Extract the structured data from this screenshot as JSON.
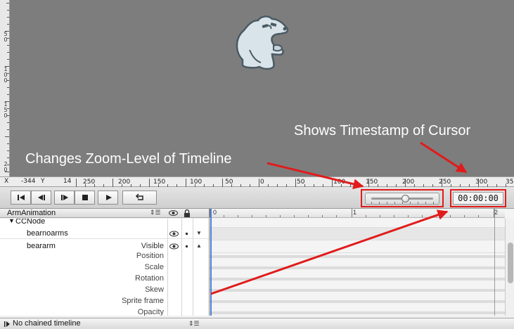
{
  "annotations": {
    "timestamp_note": "Shows Timestamp of Cursor",
    "zoom_note": "Changes Zoom-Level of Timeline",
    "arrow_color": "#e11b1b"
  },
  "ruler": {
    "x_label": "X",
    "x_value": "-344",
    "y_label": "Y",
    "y_value": "14",
    "h_ticks": [
      "250",
      "200",
      "150",
      "100",
      "50",
      "0",
      "50",
      "100",
      "150",
      "200",
      "250",
      "300",
      "35"
    ],
    "v_ticks": [
      "0",
      "5 0",
      "1 0 0",
      "1 5 0",
      "2 0"
    ]
  },
  "toolbar": {
    "buttons": [
      "jump-start",
      "step-back",
      "step-forward",
      "stop",
      "play",
      "loop"
    ],
    "zoom_level": 0.55,
    "timestamp": "00:00:00"
  },
  "timeline": {
    "sequence_name": "ArmAnimation",
    "root_node": "CCNode",
    "nodes": [
      {
        "name": "bearnoarms"
      },
      {
        "name": "beararm",
        "prop": "Visible"
      }
    ],
    "properties": [
      "Position",
      "Scale",
      "Rotation",
      "Skew",
      "Sprite frame",
      "Opacity"
    ],
    "ruler_labels": [
      "0",
      "1",
      "2"
    ],
    "footer": "No chained timeline"
  },
  "colors": {
    "canvas": "#7d7d7d",
    "highlight": "#e11b1b",
    "cursor": "#4b7fd6"
  }
}
